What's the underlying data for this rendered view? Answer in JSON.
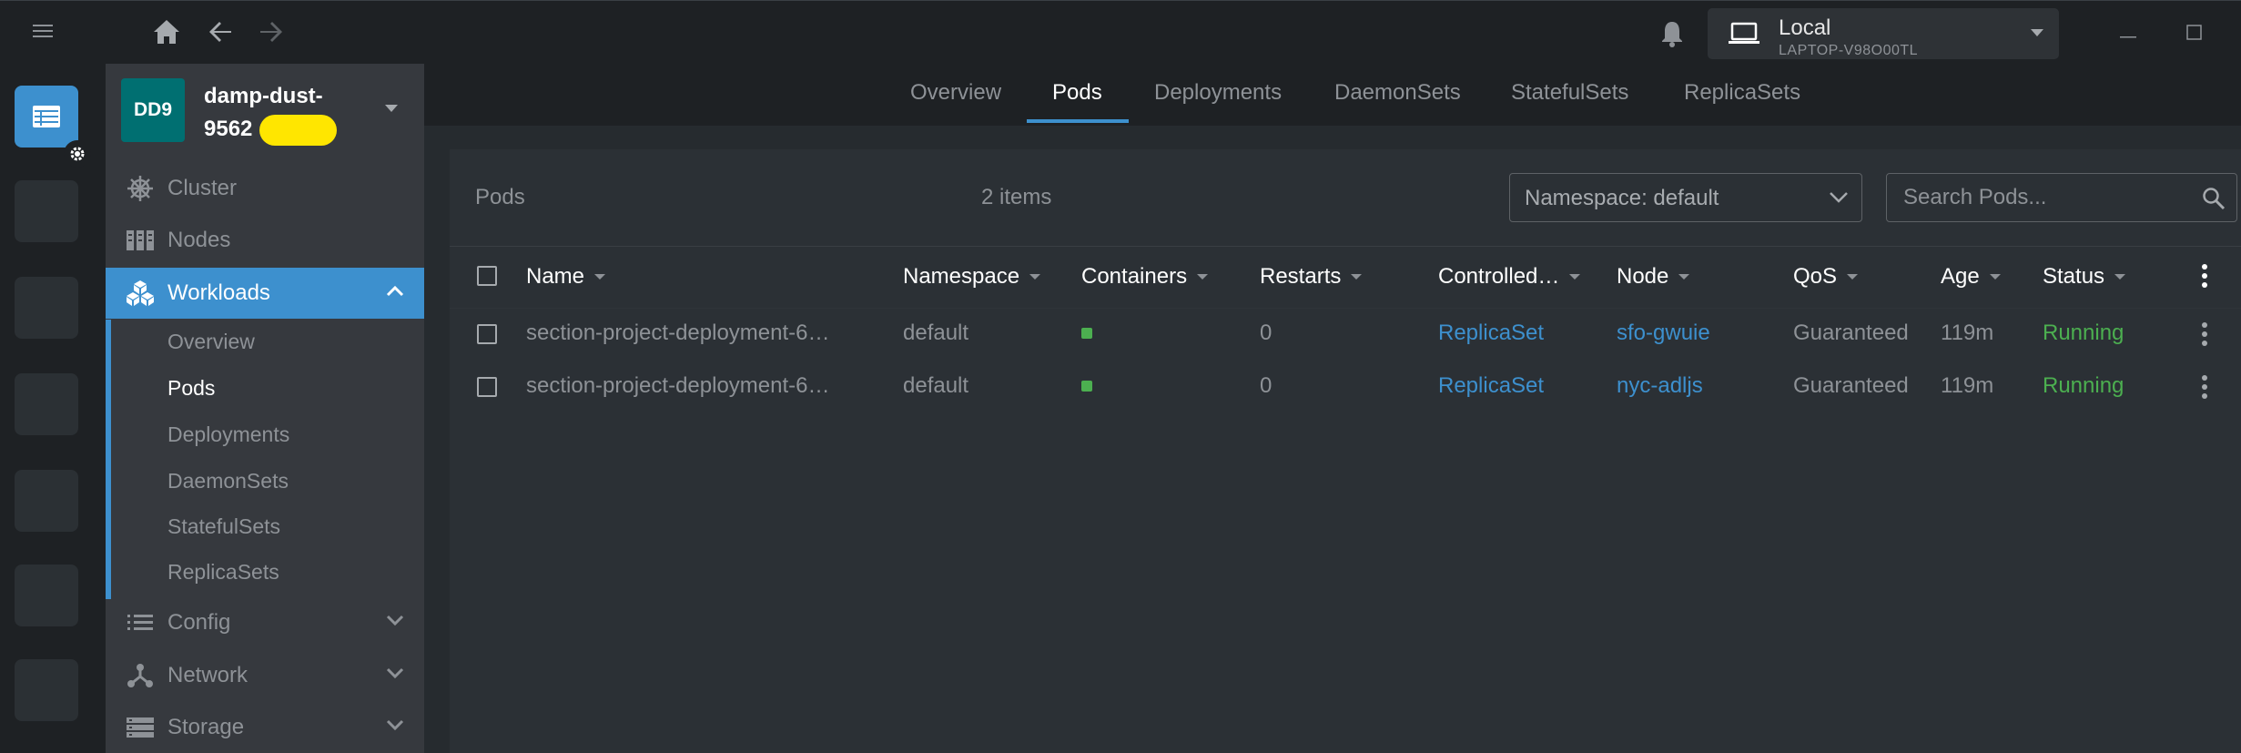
{
  "context": {
    "name": "Local",
    "host": "LAPTOP-V98O00TL"
  },
  "cluster": {
    "avatar": "DD9",
    "name": "damp-dust-9562"
  },
  "nav": {
    "cluster": "Cluster",
    "nodes": "Nodes",
    "workloads": "Workloads",
    "workloads_sub": [
      "Overview",
      "Pods",
      "Deployments",
      "DaemonSets",
      "StatefulSets",
      "ReplicaSets"
    ],
    "config": "Config",
    "network": "Network",
    "storage": "Storage"
  },
  "tabs": [
    "Overview",
    "Pods",
    "Deployments",
    "DaemonSets",
    "StatefulSets",
    "ReplicaSets"
  ],
  "selected_tab": "Pods",
  "panel": {
    "title": "Pods",
    "count": "2 items",
    "namespace_label": "Namespace: default",
    "search_placeholder": "Search Pods..."
  },
  "table": {
    "columns": [
      "Name",
      "Namespace",
      "Containers",
      "Restarts",
      "Controlled…",
      "Node",
      "QoS",
      "Age",
      "Status"
    ],
    "rows": [
      {
        "name": "section-project-deployment-6…",
        "namespace": "default",
        "restarts": "0",
        "controlled": "ReplicaSet",
        "node": "sfo-gwuie",
        "qos": "Guaranteed",
        "age": "119m",
        "status": "Running"
      },
      {
        "name": "section-project-deployment-6…",
        "namespace": "default",
        "restarts": "0",
        "controlled": "ReplicaSet",
        "node": "nyc-adljs",
        "qos": "Guaranteed",
        "age": "119m",
        "status": "Running"
      }
    ]
  },
  "colors": {
    "accent": "#3d90ce",
    "running": "#4caf50",
    "avatar": "#006f71"
  }
}
